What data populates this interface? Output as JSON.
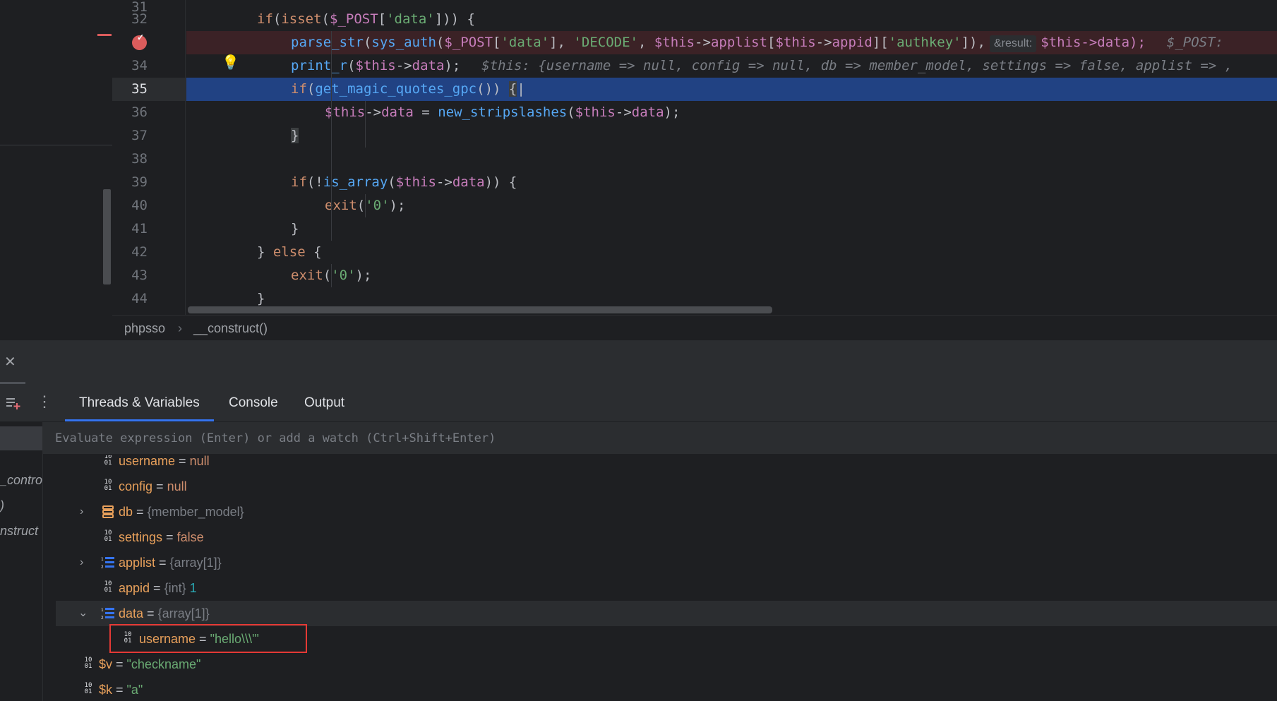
{
  "editor": {
    "lines": [
      {
        "num": "31",
        "code": ""
      },
      {
        "num": "32",
        "code": "if(isset($_POST['data'])) {"
      },
      {
        "num": "33",
        "code": "parse_str(sys_auth($_POST['data'], 'DECODE', $this->applist[$this->appid]['authkey']),",
        "hint_label": "&result:",
        "hint_value": "$this->data);",
        "trailing_hint": "$_POST:"
      },
      {
        "num": "34",
        "code": "print_r($this->data);",
        "trailing_hint": "$this: {username => null, config => null, db => member_model, settings => false, applist => ,"
      },
      {
        "num": "35",
        "code": "if(get_magic_quotes_gpc()) {"
      },
      {
        "num": "36",
        "code": "$this->data = new_stripslashes($this->data);"
      },
      {
        "num": "37",
        "code": "}"
      },
      {
        "num": "38",
        "code": ""
      },
      {
        "num": "39",
        "code": "if(!is_array($this->data)) {"
      },
      {
        "num": "40",
        "code": "exit('0');"
      },
      {
        "num": "41",
        "code": "}"
      },
      {
        "num": "42",
        "code": "} else {"
      },
      {
        "num": "43",
        "code": "exit('0');"
      },
      {
        "num": "44",
        "code": "}"
      }
    ]
  },
  "breadcrumb": {
    "item1": "phpsso",
    "separator": "›",
    "item2": "__construct()"
  },
  "debug": {
    "tabs": {
      "threads_variables": "Threads & Variables",
      "console": "Console",
      "output": "Output"
    },
    "eval_placeholder": "Evaluate expression (Enter) or add a watch (Ctrl+Shift+Enter)",
    "frames": [
      "",
      "_contro",
      ")",
      "nstruct"
    ],
    "variables": [
      {
        "name": "username",
        "eq": " = ",
        "value": "null",
        "kind": "null"
      },
      {
        "name": "config",
        "eq": " = ",
        "value": "null",
        "kind": "null"
      },
      {
        "name": "db",
        "eq": " = ",
        "value": "{member_model}",
        "kind": "type"
      },
      {
        "name": "settings",
        "eq": " = ",
        "value": "false",
        "kind": "null"
      },
      {
        "name": "applist",
        "eq": " = ",
        "value": "{array[1]}",
        "kind": "type"
      },
      {
        "name": "appid",
        "eq": " = ",
        "type": "{int}",
        "value": "1",
        "kind": "num"
      },
      {
        "name": "data",
        "eq": " = ",
        "value": "{array[1]}",
        "kind": "type"
      },
      {
        "name": "username",
        "eq": " = ",
        "value": "\"hello\\\\\\'\"",
        "kind": "str"
      },
      {
        "name": "$v",
        "eq": " = ",
        "value": "\"checkname\"",
        "kind": "str"
      },
      {
        "name": "$k",
        "eq": " = ",
        "value": "\"a\"",
        "kind": "str"
      }
    ]
  },
  "colors": {
    "accent": "#3574f0",
    "breakpoint": "#db5c5c",
    "current_line": "#214283",
    "callout": "#e53935"
  }
}
